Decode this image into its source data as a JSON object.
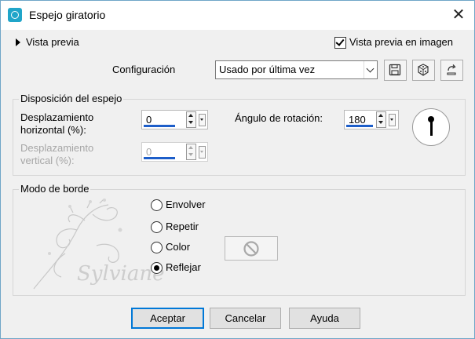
{
  "window": {
    "title": "Espejo giratorio",
    "accent": "#0078d7"
  },
  "preview": {
    "toggle_label": "Vista previa",
    "checkbox_label": "Vista previa en imagen",
    "checked": true
  },
  "config": {
    "label": "Configuración",
    "selected": "Usado por última vez"
  },
  "toolbar": {
    "icons": [
      "save-icon",
      "random-dice-icon",
      "reset-icon"
    ]
  },
  "mirror_group": {
    "title": "Disposición del espejo",
    "h_label_1": "Desplazamiento",
    "h_label_2": "horizontal (%):",
    "h_value": "0",
    "v_label_1": "Desplazamiento",
    "v_label_2": "vertical (%):",
    "v_value": "0",
    "angle_label": "Ángulo de rotación:",
    "angle_value": "180"
  },
  "border_group": {
    "title": "Modo de borde",
    "options": [
      "Envolver",
      "Repetir",
      "Color",
      "Reflejar"
    ],
    "selected": "Reflejar",
    "watermark": "Sylviane"
  },
  "buttons": {
    "ok": "Aceptar",
    "cancel": "Cancelar",
    "help": "Ayuda"
  }
}
